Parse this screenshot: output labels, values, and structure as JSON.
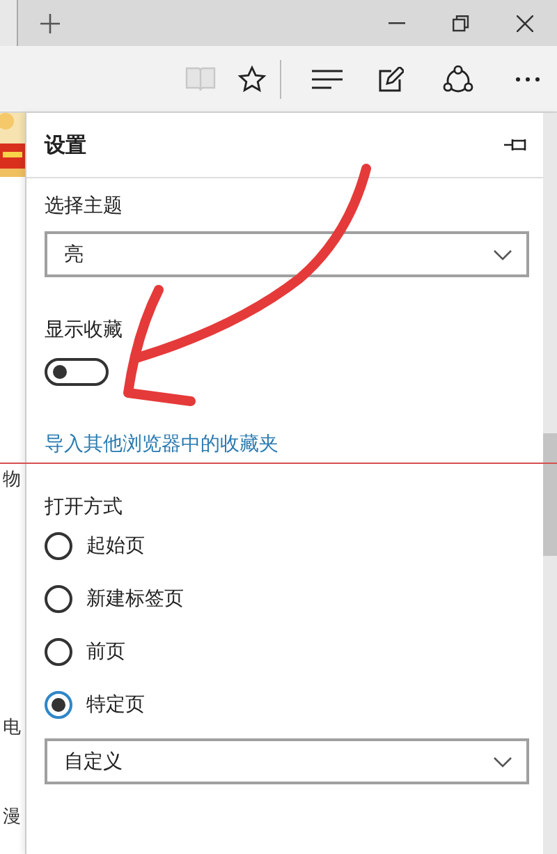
{
  "page_behind": {
    "texts": [
      "物",
      "电",
      "漫"
    ]
  },
  "settings": {
    "title": "设置",
    "theme": {
      "label": "选择主题",
      "value": "亮"
    },
    "favorites_bar": {
      "label": "显示收藏",
      "on": false
    },
    "import_link": "导入其他浏览器中的收藏夹",
    "open_with": {
      "label": "打开方式",
      "options": [
        {
          "label": "起始页",
          "selected": false
        },
        {
          "label": "新建标签页",
          "selected": false
        },
        {
          "label": "前页",
          "selected": false
        },
        {
          "label": "特定页",
          "selected": true
        }
      ]
    },
    "custom_page": {
      "value": "自定义"
    }
  }
}
